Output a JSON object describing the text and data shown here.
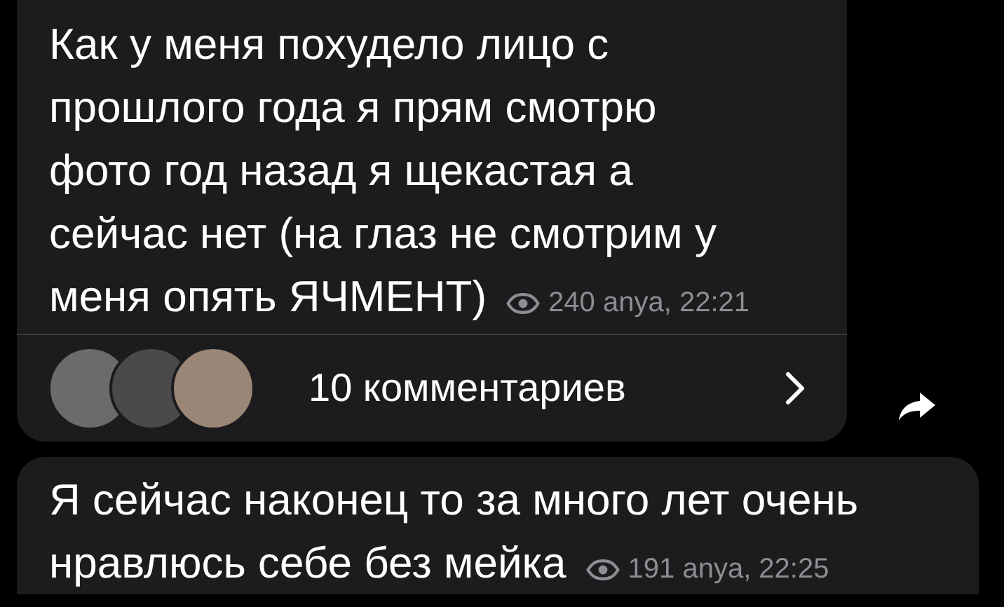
{
  "messages": [
    {
      "lines": [
        "Как у меня похудело лицо с",
        "прошлого года я прям смотрю",
        "фото год назад я щекастая а",
        "сейчас нет (на глаз не смотрим у",
        "меня опять ЯЧМЕНТ)"
      ],
      "views": "240",
      "meta": "anya, 22:21",
      "comments": {
        "label": "10 комментариев"
      },
      "forward": true
    },
    {
      "lines": [
        "Я сейчас наконец то за много лет очень",
        "нравлюсь себе без мейка"
      ],
      "views": "191",
      "meta": "anya, 22:25",
      "forward": false
    }
  ]
}
